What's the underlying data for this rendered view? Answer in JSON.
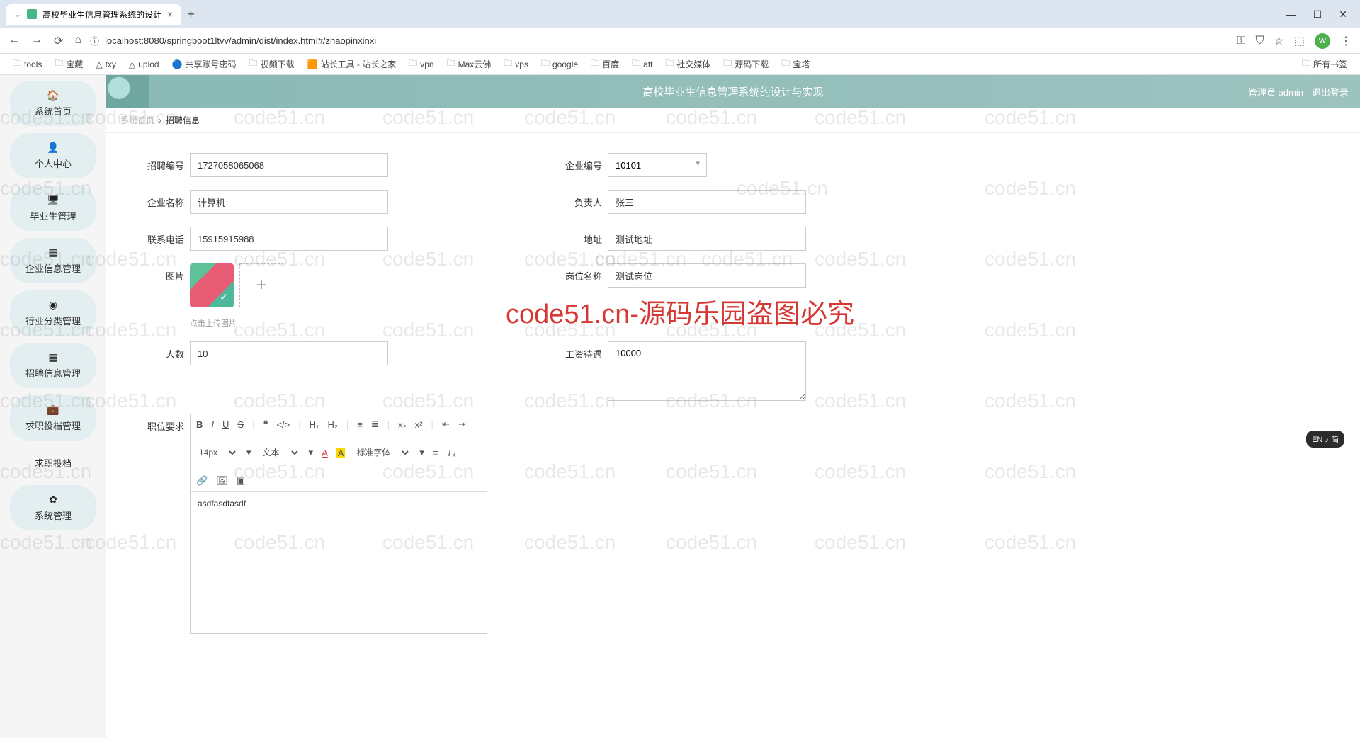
{
  "browser": {
    "tab_title": "高校毕业生信息管理系统的设计",
    "url": "localhost:8080/springboot1ltvv/admin/dist/index.html#/zhaopinxinxi",
    "bookmarks": [
      "tools",
      "宝藏",
      "txy",
      "uplod",
      "共享账号密码",
      "视频下载",
      "站长工具 - 站长之家",
      "vpn",
      "Max云佛",
      "vps",
      "google",
      "百度",
      "aff",
      "社交媒体",
      "源码下载",
      "宝塔"
    ],
    "all_bookmarks": "所有书签",
    "user_initial": "W"
  },
  "sidebar": {
    "items": [
      {
        "icon": "🏠",
        "label": "系统首页"
      },
      {
        "icon": "👤",
        "label": "个人中心"
      },
      {
        "icon": "🖥",
        "label": "毕业生管理"
      },
      {
        "icon": "▦",
        "label": "企业信息管理"
      },
      {
        "icon": "◉",
        "label": "行业分类管理"
      },
      {
        "icon": "▦",
        "label": "招聘信息管理"
      },
      {
        "icon": "💼",
        "label": "求职投档管理"
      },
      {
        "icon": "",
        "label": "求职投档"
      },
      {
        "icon": "✿",
        "label": "系统管理"
      }
    ]
  },
  "banner": {
    "title": "高校毕业生信息管理系统的设计与实现",
    "user": "管理员 admin",
    "logout": "退出登录"
  },
  "breadcrumb": {
    "home": "系统首页",
    "sep": "›",
    "current": "招聘信息"
  },
  "form": {
    "recruit_no": {
      "label": "招聘编号",
      "value": "1727058065068"
    },
    "company_no": {
      "label": "企业编号",
      "value": "10101"
    },
    "company_name": {
      "label": "企业名称",
      "value": "计算机"
    },
    "contact_person": {
      "label": "负责人",
      "value": "张三"
    },
    "phone": {
      "label": "联系电话",
      "value": "15915915988"
    },
    "address": {
      "label": "地址",
      "value": "测试地址"
    },
    "image": {
      "label": "图片",
      "hint": "点击上传图片"
    },
    "position": {
      "label": "岗位名称",
      "value": "测试岗位"
    },
    "count": {
      "label": "人数",
      "value": "10"
    },
    "salary": {
      "label": "工资待遇",
      "value": "10000"
    },
    "requirements": {
      "label": "职位要求",
      "value": "asdfasdfasdf"
    }
  },
  "editor": {
    "font_size": "14px",
    "text_type": "文本",
    "font_family": "标准字体"
  },
  "watermark": "code51.cn",
  "watermark_big": "code51.cn-源码乐园盗图必究",
  "ime": "EN ♪ 简"
}
